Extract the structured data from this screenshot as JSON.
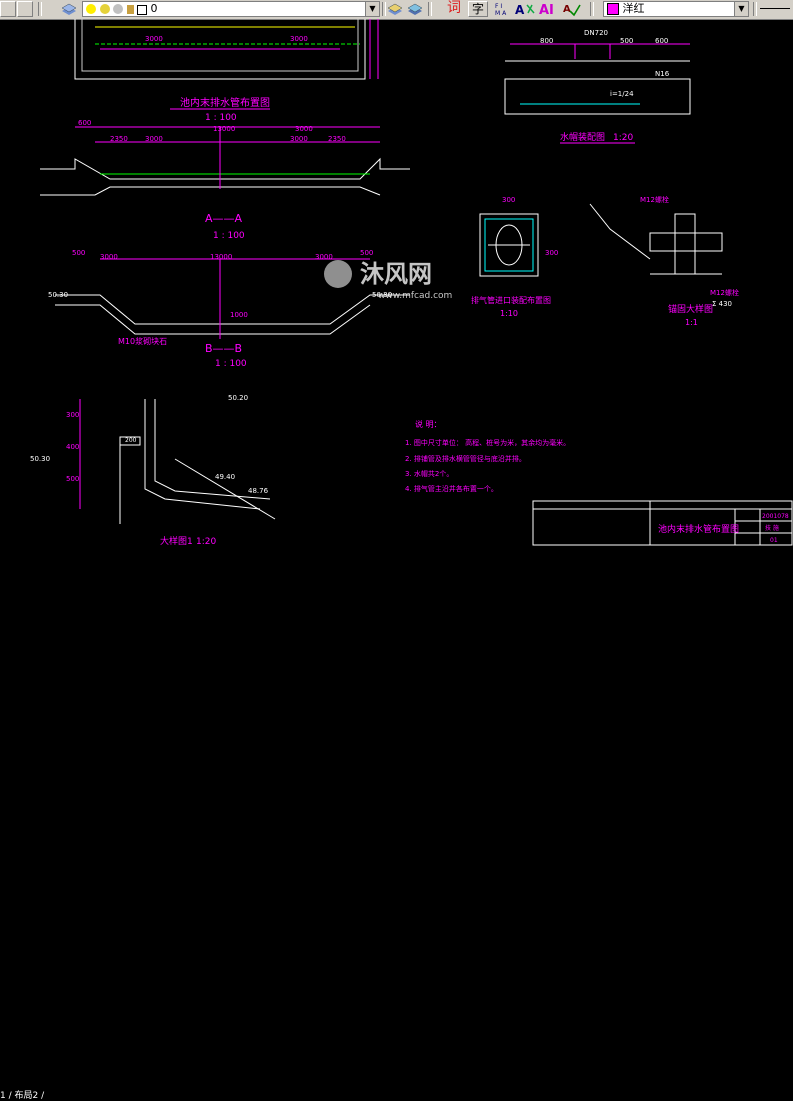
{
  "toolbar": {
    "layer_value": "0",
    "color_value": "洋红",
    "text_style_label": "词",
    "text_label": "字"
  },
  "watermark": {
    "brand": "沐风网",
    "url": "www.mfcad.com"
  },
  "drawing": {
    "title1": "池内末排水管布置图",
    "scale1": "1 : 100",
    "dim_3000": "3000",
    "dim_3000b": "3000",
    "dim_600": "600",
    "dim_13000": "13000",
    "dim_3000c": "3000",
    "dim_3000d": "3000",
    "dim_2350": "2350",
    "dim_2350b": "2350",
    "dim_3000e": "3000",
    "dim_3000f": "3000",
    "dim_600b": "600",
    "section_aa": "A——A",
    "scale_aa": "1 : 100",
    "dim_500": "500",
    "dim_3000g": "3000",
    "dim_13000b": "13000",
    "dim_3000h": "3000",
    "dim_500b": "500",
    "elev_5030": "50.30",
    "elev_5030b": "50.30",
    "section_bb": "B——B",
    "scale_bb": "1 : 100",
    "mortar_label": "M10浆砌块石",
    "dim_1000": "1000",
    "detail_title1": "水帽装配图",
    "detail_scale1": "1:20",
    "dim_dn720": "DN720",
    "dim_800": "800",
    "dim_500c": "500",
    "dim_600c": "600",
    "rebar_n16": "N16",
    "slope_label": "i=1/24",
    "detail_title2": "排气管进口装配布置图",
    "detail_scale2": "1:10",
    "dim_300": "300",
    "dim_300b": "300",
    "detail_title3": "锚固大样图",
    "detail_scale3": "1:1",
    "m12_label1": "M12螺栓",
    "m12_label2": "M12螺栓",
    "dim_430": "Σ 430",
    "detail_title4": "大样图1",
    "detail_scale4": "1:20",
    "dim_300c": "300",
    "dim_400": "400",
    "dim_500d": "500",
    "dim_300d": "300",
    "dim_200": "200",
    "elev_5030c": "50.30",
    "elev_4940": "49.40",
    "elev_4876": "48.76",
    "elev_5020": "50.20",
    "notes_heading": "说 明：",
    "note1": "1. 图中尺寸单位： 高程、桩号为米，其余均为毫米。",
    "note2": "2. 排铺管及排水横管管径与底沿并排。",
    "note3": "3. 水帽共2个。",
    "note4": "4. 排气管主沿井各布置一个。",
    "titleblock_name": "池内末排水管布置图",
    "titleblock_no": "2001078",
    "titleblock_stage": "技 施",
    "titleblock_sheet": "01"
  },
  "status": {
    "tab_label": "1 / 布局2 /"
  }
}
